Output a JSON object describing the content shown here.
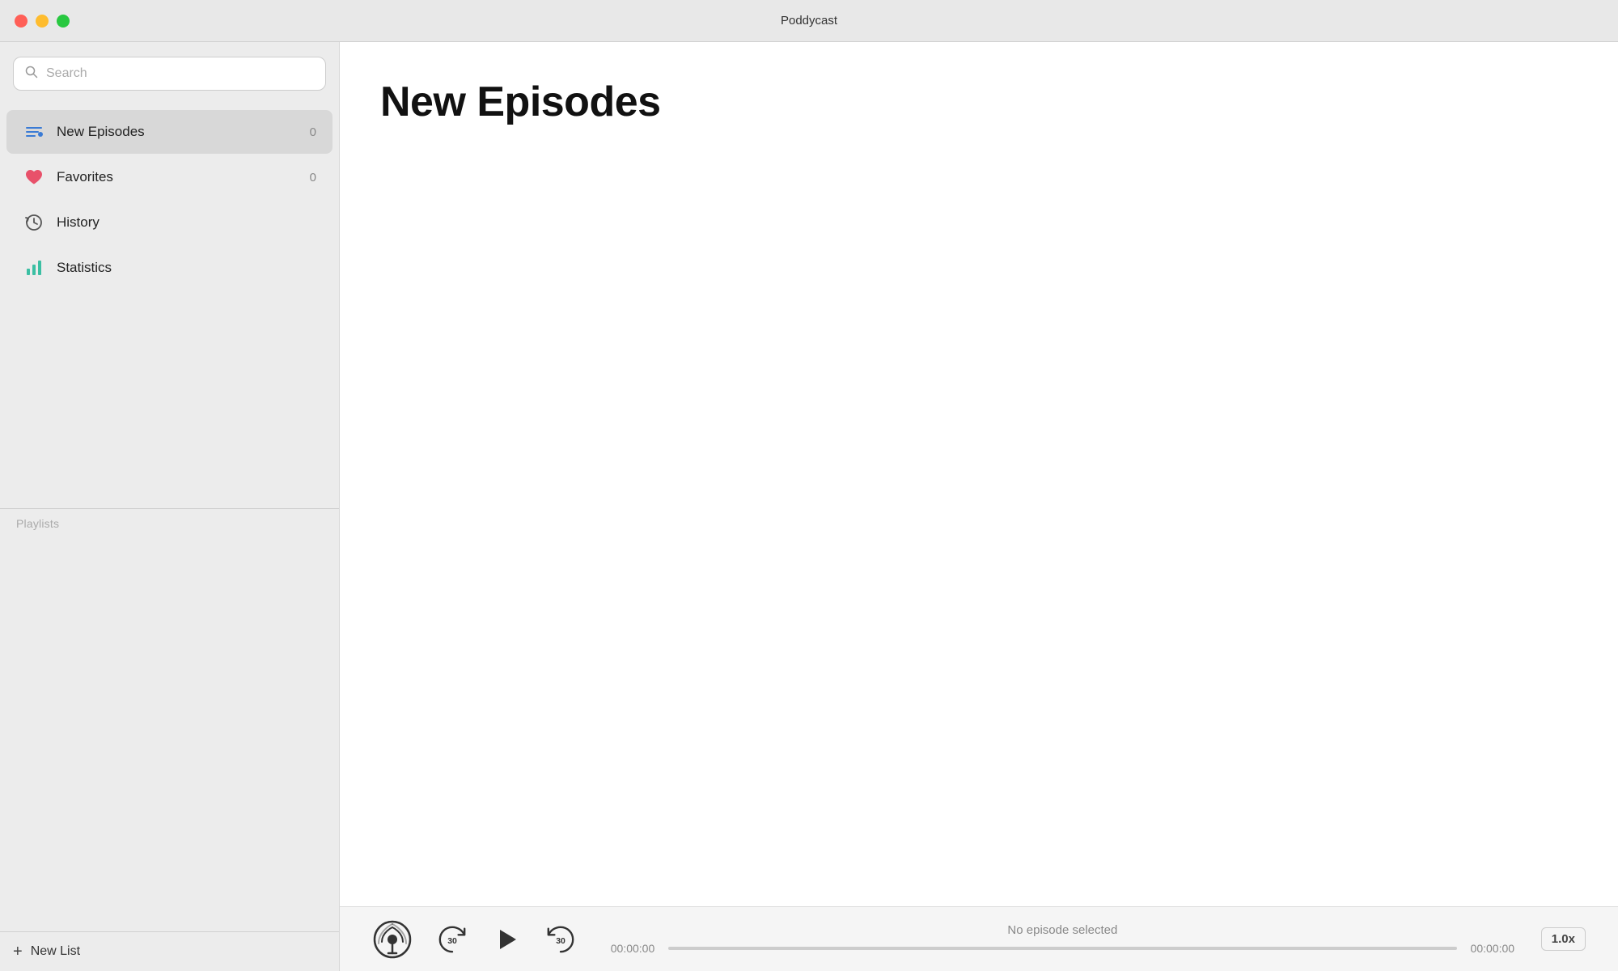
{
  "app": {
    "title": "Poddycast"
  },
  "window_controls": {
    "close": "close",
    "minimize": "minimize",
    "maximize": "maximize"
  },
  "sidebar": {
    "search": {
      "placeholder": "Search"
    },
    "nav_items": [
      {
        "id": "new-episodes",
        "label": "New Episodes",
        "badge": "0",
        "active": true,
        "icon": "new-episodes-icon"
      },
      {
        "id": "favorites",
        "label": "Favorites",
        "badge": "0",
        "active": false,
        "icon": "heart-icon"
      },
      {
        "id": "history",
        "label": "History",
        "badge": "",
        "active": false,
        "icon": "history-icon"
      },
      {
        "id": "statistics",
        "label": "Statistics",
        "badge": "",
        "active": false,
        "icon": "statistics-icon"
      }
    ],
    "playlists_label": "Playlists",
    "new_list_label": "New List",
    "new_list_plus": "+"
  },
  "content": {
    "title": "New Episodes"
  },
  "player": {
    "episode_info": "No episode selected",
    "time_start": "00:00:00",
    "time_end": "00:00:00",
    "speed": "1.0x",
    "progress": 0
  }
}
